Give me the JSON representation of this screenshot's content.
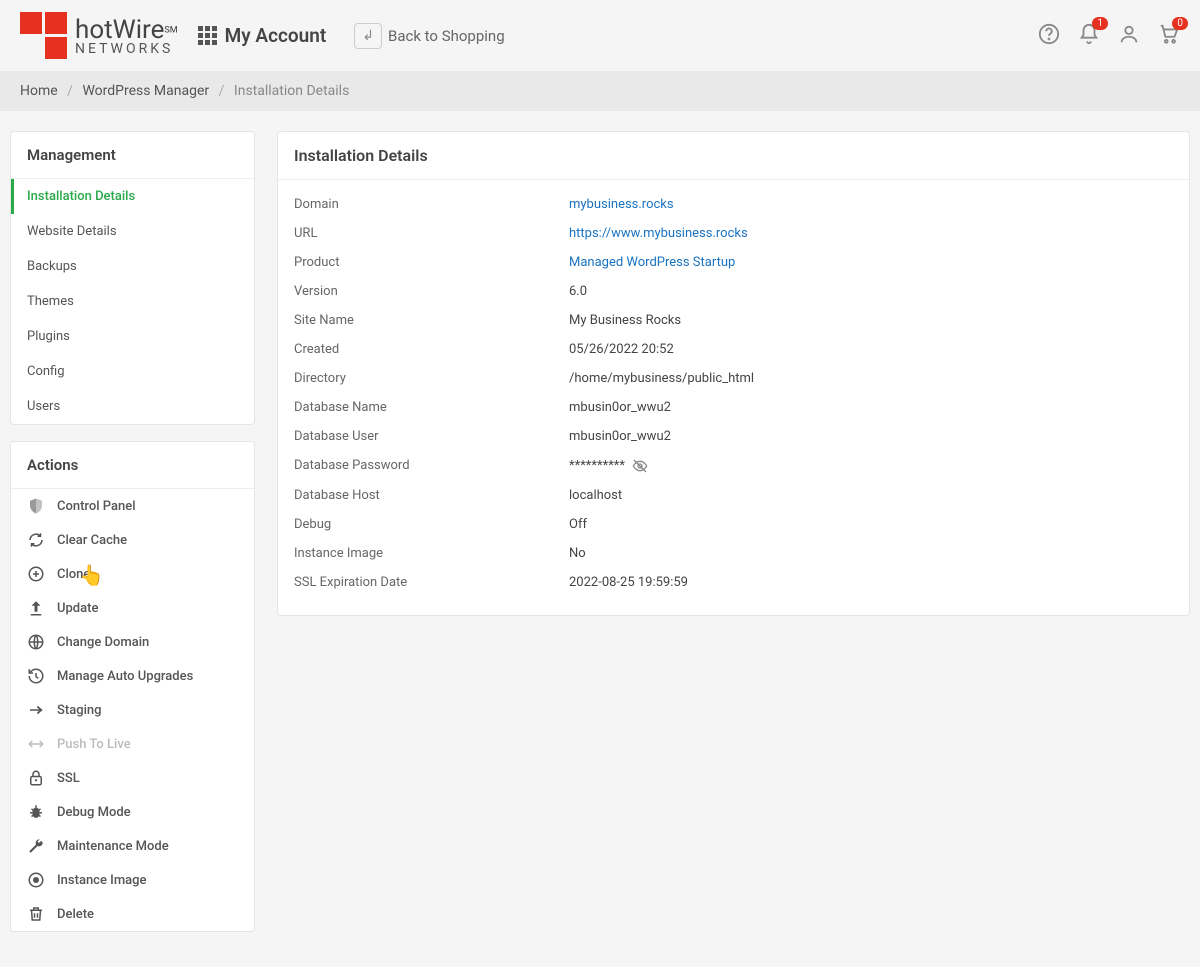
{
  "header": {
    "brand_main": "hotWire",
    "brand_sm": "SM",
    "brand_sub": "NETWORKS",
    "my_account": "My Account",
    "back": "Back to Shopping",
    "notif_count": "1",
    "cart_count": "0"
  },
  "breadcrumb": {
    "home": "Home",
    "section": "WordPress Manager",
    "current": "Installation Details"
  },
  "management": {
    "title": "Management",
    "items": [
      {
        "label": "Installation Details",
        "active": true
      },
      {
        "label": "Website Details"
      },
      {
        "label": "Backups"
      },
      {
        "label": "Themes"
      },
      {
        "label": "Plugins"
      },
      {
        "label": "Config"
      },
      {
        "label": "Users"
      }
    ]
  },
  "actions": {
    "title": "Actions",
    "items": [
      {
        "icon": "shield-icon",
        "label": "Control Panel"
      },
      {
        "icon": "refresh-icon",
        "label": "Clear Cache"
      },
      {
        "icon": "clone-icon",
        "label": "Clone"
      },
      {
        "icon": "upload-icon",
        "label": "Update"
      },
      {
        "icon": "globe-icon",
        "label": "Change Domain"
      },
      {
        "icon": "history-icon",
        "label": "Manage Auto Upgrades"
      },
      {
        "icon": "arrow-right-icon",
        "label": "Staging"
      },
      {
        "icon": "push-icon",
        "label": "Push To Live",
        "disabled": true
      },
      {
        "icon": "lock-icon",
        "label": "SSL"
      },
      {
        "icon": "bug-icon",
        "label": "Debug Mode"
      },
      {
        "icon": "wrench-icon",
        "label": "Maintenance Mode"
      },
      {
        "icon": "image-icon",
        "label": "Instance Image"
      },
      {
        "icon": "trash-icon",
        "label": "Delete"
      }
    ]
  },
  "details": {
    "title": "Installation Details",
    "rows": [
      {
        "label": "Domain",
        "value": "mybusiness.rocks",
        "link": true
      },
      {
        "label": "URL",
        "value": "https://www.mybusiness.rocks",
        "link": true
      },
      {
        "label": "Product",
        "value": "Managed WordPress Startup",
        "link": true
      },
      {
        "label": "Version",
        "value": "6.0"
      },
      {
        "label": "Site Name",
        "value": "My Business Rocks"
      },
      {
        "label": "Created",
        "value": "05/26/2022 20:52"
      },
      {
        "label": "Directory",
        "value": "/home/mybusiness/public_html"
      },
      {
        "label": "Database Name",
        "value": "mbusin0or_wwu2"
      },
      {
        "label": "Database User",
        "value": "mbusin0or_wwu2"
      },
      {
        "label": "Database Password",
        "value": "**********",
        "eye": true
      },
      {
        "label": "Database Host",
        "value": "localhost"
      },
      {
        "label": "Debug",
        "value": "Off"
      },
      {
        "label": "Instance Image",
        "value": "No"
      },
      {
        "label": "SSL Expiration Date",
        "value": "2022-08-25 19:59:59"
      }
    ]
  }
}
